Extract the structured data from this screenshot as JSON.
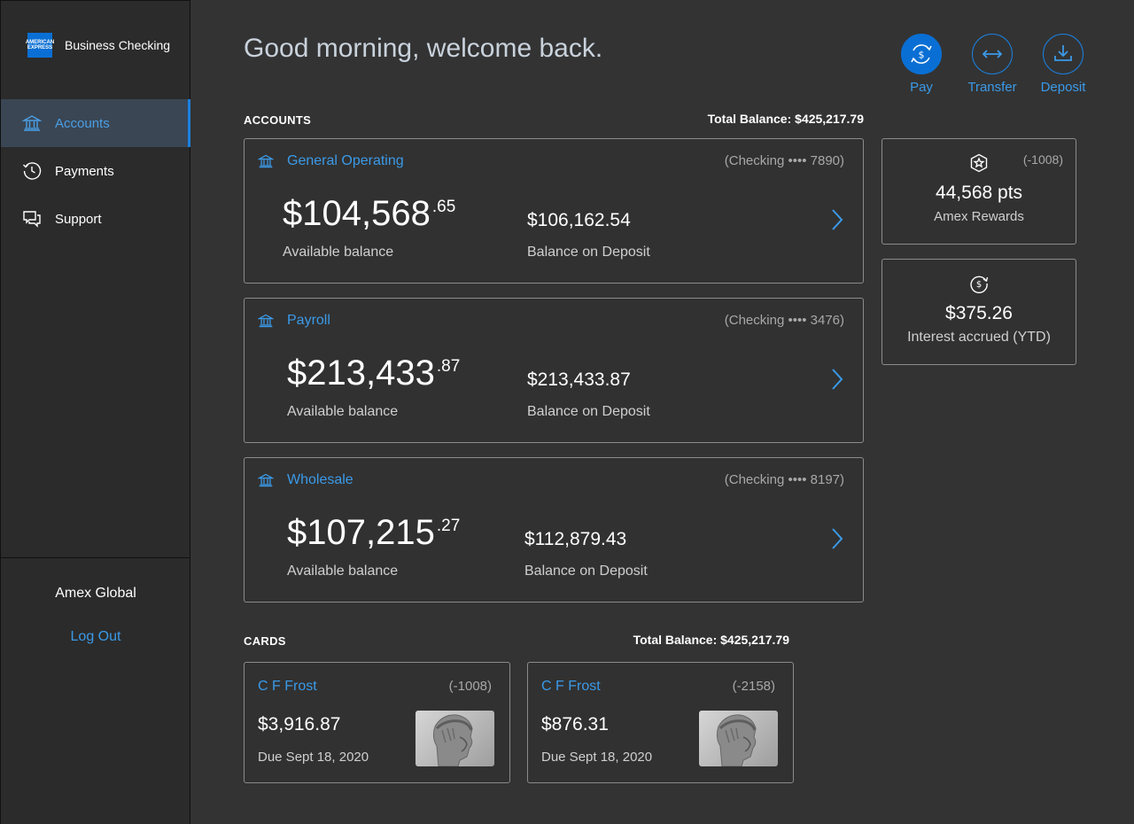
{
  "brand": {
    "logo_text": "AMERICAN EXPRESS",
    "title": "Business Checking"
  },
  "nav": {
    "items": [
      {
        "label": "Accounts",
        "icon": "bank-icon",
        "active": true
      },
      {
        "label": "Payments",
        "icon": "clock-icon",
        "active": false
      },
      {
        "label": "Support",
        "icon": "chat-icon",
        "active": false
      }
    ]
  },
  "user": {
    "name": "Amex Global",
    "logout_label": "Log Out"
  },
  "greeting": "Good morning, welcome back.",
  "actions": [
    {
      "label": "Pay",
      "icon": "pay-icon"
    },
    {
      "label": "Transfer",
      "icon": "transfer-icon"
    },
    {
      "label": "Deposit",
      "icon": "deposit-icon"
    }
  ],
  "accounts_section": {
    "heading": "ACCOUNTS",
    "total": "Total Balance: $425,217.79",
    "accounts": [
      {
        "name": "General Operating",
        "number": "(Checking •••• 7890)",
        "available_whole": "$104,568",
        "available_cents": ".65",
        "available_label": "Available balance",
        "deposit": "$106,162.54",
        "deposit_label": "Balance on Deposit"
      },
      {
        "name": "Payroll",
        "number": "(Checking •••• 3476)",
        "available_whole": "$213,433",
        "available_cents": ".87",
        "available_label": "Available balance",
        "deposit": "$213,433.87",
        "deposit_label": "Balance on Deposit"
      },
      {
        "name": "Wholesale",
        "number": "(Checking •••• 8197)",
        "available_whole": "$107,215",
        "available_cents": ".27",
        "available_label": "Available balance",
        "deposit": "$112,879.43",
        "deposit_label": "Balance on Deposit"
      }
    ]
  },
  "rewards": {
    "account": "(-1008)",
    "value": "44,568 pts",
    "label": "Amex Rewards",
    "icon": "star-badge-icon"
  },
  "interest": {
    "value": "$375.26",
    "label": "Interest accrued (YTD)",
    "icon": "dollar-cycle-icon"
  },
  "cards_section": {
    "heading": "CARDS",
    "total": "Total Balance: $425,217.79",
    "cards": [
      {
        "name": "C F Frost",
        "number": "(-1008)",
        "balance": "$3,916.87",
        "due": "Due Sept 18, 2020"
      },
      {
        "name": "C F Frost",
        "number": "(-2158)",
        "balance": "$876.31",
        "due": "Due Sept 18, 2020"
      }
    ]
  },
  "colors": {
    "accent": "#1b80e0",
    "link": "#3b9ae8",
    "background": "#333333",
    "sidebar": "#2b2b2b"
  }
}
